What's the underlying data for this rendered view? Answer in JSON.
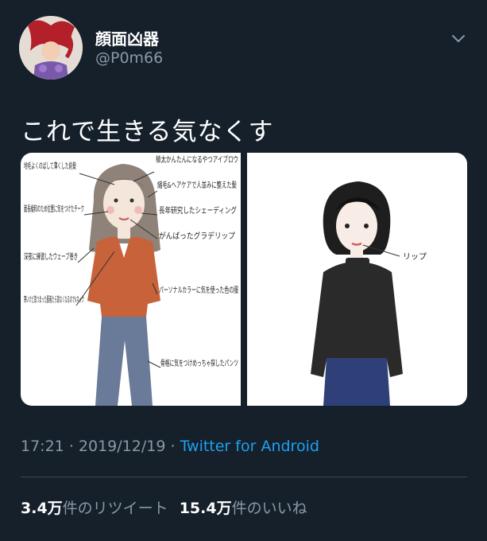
{
  "user": {
    "display_name": "顔面凶器",
    "handle": "@P0m66"
  },
  "tweet": {
    "text": "これで生きる気なくす",
    "time": "17:21",
    "separator": "·",
    "date": "2019/12/19",
    "source": "Twitter for Android"
  },
  "stats": {
    "retweets_count": "3.4万",
    "retweets_label": "件のリツイート",
    "likes_count": "15.4万",
    "likes_label": "件のいいね"
  },
  "illustration": {
    "left_notes": [
      "地毛よくのばして薄くした前髪",
      "面長緩和のため位置に気をつけたチーク",
      "深夜に練習したウェーブ巻き",
      "寒いけど首つまった服着たら首なくなるのでVネック",
      "極太かんたんになるやつアイブロウ",
      "縮毛&ヘアケアで人並みに整えた髪",
      "長年研究したシェーディング",
      "がんばったグラデリップ",
      "パーソナルカラーに気を使った色の服",
      "骨格に気をつけめっちゃ探したパンツ"
    ],
    "right_notes": [
      "リップ"
    ]
  },
  "colors": {
    "background": "#15202b",
    "muted_text": "#8899a6",
    "link": "#1da1f2",
    "divider": "#38444d"
  },
  "icons": {
    "menu": "chevron-down-icon"
  }
}
